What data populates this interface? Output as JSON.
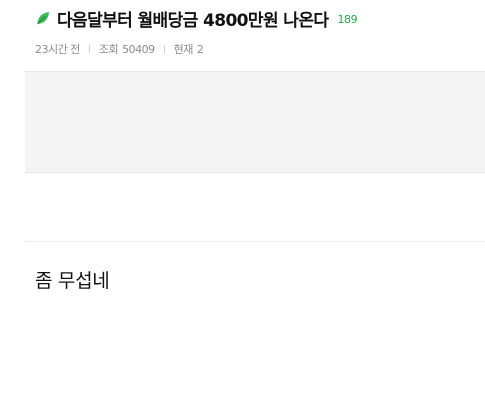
{
  "post": {
    "title": "다음달부터 월배당금 4800만원 나온다",
    "comment_count": "189",
    "title_icon": "leaf-icon",
    "accent_color": "#27a74a",
    "meta": {
      "time_ago": "23시간 전",
      "views_label": "조회",
      "views_value": "50409",
      "current_label": "현재",
      "current_value": "2"
    },
    "body": "좀 무섭네"
  }
}
